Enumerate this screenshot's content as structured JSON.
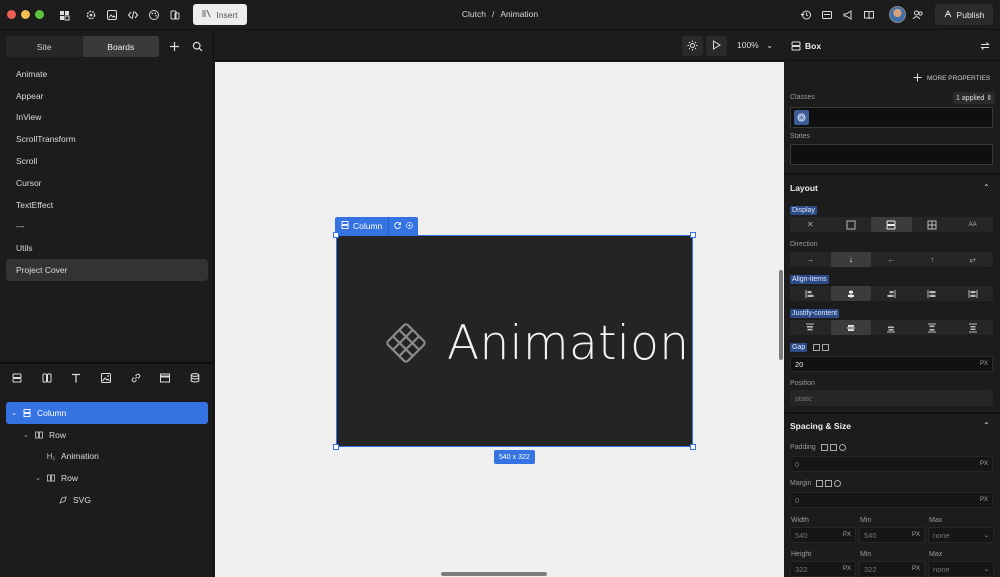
{
  "colors": {
    "accent": "#3573e3",
    "traffic_red": "#ee5f57",
    "traffic_yellow": "#f4bd4f",
    "traffic_green": "#5ac53d",
    "canvas_bg": "#efeff0",
    "frame_bg": "#242424"
  },
  "topbar": {
    "insert_label": "Insert",
    "breadcrumb": {
      "project": "Clutch",
      "separator": "/",
      "page": "Animation"
    },
    "publish_label": "Publish"
  },
  "left_panel": {
    "tabs": [
      "Site",
      "Boards"
    ],
    "active_tab": "Boards",
    "boards": [
      "Animate",
      "Appear",
      "InView",
      "ScrollTransform",
      "Scroll",
      "Cursor",
      "TextEffect",
      "---",
      "Utils",
      "Project Cover"
    ],
    "selected_board": "Project Cover",
    "tree": [
      {
        "label": "Column",
        "depth": 0,
        "icon": "column-icon",
        "expanded": true,
        "selected": true
      },
      {
        "label": "Row",
        "depth": 1,
        "icon": "row-icon",
        "expanded": true,
        "selected": false
      },
      {
        "label": "Animation",
        "depth": 2,
        "icon": "heading-icon",
        "expanded": false,
        "selected": false
      },
      {
        "label": "Row",
        "depth": 2,
        "icon": "row-icon",
        "expanded": true,
        "selected": false
      },
      {
        "label": "SVG",
        "depth": 3,
        "icon": "svg-icon",
        "expanded": false,
        "selected": false
      }
    ]
  },
  "canvas": {
    "zoom_label": "100%",
    "element_label": "Column",
    "frame_title": "Animation",
    "size_label": "540 x 322"
  },
  "right_panel": {
    "title": "Box",
    "more_properties": "MORE PROPERTIES",
    "classes_label": "Classes",
    "classes_applied": "1 applied",
    "states_label": "States",
    "layout": {
      "title": "Layout",
      "display_label": "Display",
      "direction_label": "Direction",
      "align_label": "Align-items",
      "justify_label": "Justify-content",
      "gap_label": "Gap",
      "gap_value": "20",
      "gap_unit": "PX",
      "position_label": "Position",
      "position_value": "static"
    },
    "spacing": {
      "title": "Spacing & Size",
      "padding_label": "Padding",
      "padding_value": "0",
      "margin_label": "Margin",
      "margin_value": "0",
      "unit": "PX",
      "width_label": "Width",
      "width_value": "540",
      "min_label": "Min",
      "min_width_value": "540",
      "max_label": "Max",
      "max_width_value": "none",
      "height_label": "Height",
      "height_value": "322",
      "min_height_value": "322",
      "max_height_value": "none"
    }
  }
}
